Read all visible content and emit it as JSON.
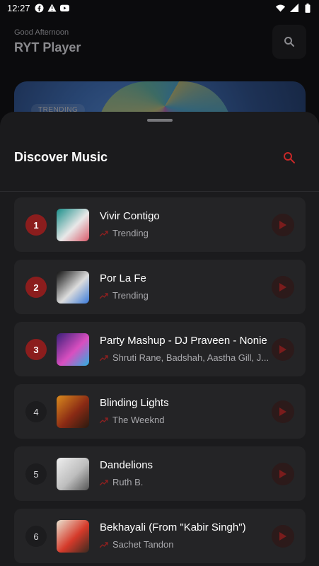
{
  "status_bar": {
    "time": "12:27",
    "left_icons": [
      "facebook-icon",
      "warning-icon",
      "youtube-icon"
    ],
    "right_icons": [
      "wifi-icon",
      "signal-icon",
      "battery-icon"
    ]
  },
  "header": {
    "greeting": "Good Afternoon",
    "title": "RYT Player",
    "search_icon": "search-icon"
  },
  "banner": {
    "tag": "TRENDING"
  },
  "sheet": {
    "title": "Discover Music",
    "search_icon": "search-icon",
    "accent_color": "#c62828"
  },
  "tracks": [
    {
      "rank": "1",
      "title": "Vivir Contigo",
      "subtitle": "Trending",
      "highlight": true,
      "art": [
        "#1a8f8a",
        "#e8e8e8",
        "#d95a6a"
      ]
    },
    {
      "rank": "2",
      "title": "Por La Fe",
      "subtitle": "Trending",
      "highlight": true,
      "art": [
        "#111111",
        "#dcdcdc",
        "#3a7ad9"
      ]
    },
    {
      "rank": "3",
      "title": "Party Mashup - DJ Praveen - Nonie",
      "subtitle": "Shruti Rane, Badshah, Aastha Gill, J...",
      "highlight": true,
      "art": [
        "#3a1f7a",
        "#d94fc0",
        "#2bb0e0"
      ]
    },
    {
      "rank": "4",
      "title": "Blinding Lights",
      "subtitle": "The Weeknd",
      "highlight": false,
      "art": [
        "#d98a1e",
        "#8a2a14",
        "#2a1a10"
      ]
    },
    {
      "rank": "5",
      "title": "Dandelions",
      "subtitle": "Ruth B.",
      "highlight": false,
      "art": [
        "#efefef",
        "#bdbdbd",
        "#555555"
      ]
    },
    {
      "rank": "6",
      "title": "Bekhayali (From \"Kabir Singh\")",
      "subtitle": "Sachet Tandon",
      "highlight": false,
      "art": [
        "#e9e2d0",
        "#d53a2a",
        "#3a2a20"
      ]
    }
  ]
}
